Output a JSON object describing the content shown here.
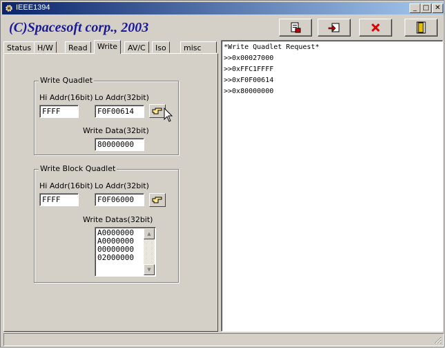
{
  "window": {
    "title": "IEEE1394"
  },
  "title_buttons": [
    "minimize",
    "maximize",
    "close"
  ],
  "header": {
    "brand": "(C)Spacesoft corp., 2003"
  },
  "toolbar": [
    {
      "name": "read-file-icon"
    },
    {
      "name": "transfer-icon"
    },
    {
      "name": "clear-icon"
    },
    {
      "name": "exit-door-icon"
    }
  ],
  "tabs": [
    "Status",
    "H/W",
    "Read",
    "Write",
    "AV/C",
    "Iso",
    "misc"
  ],
  "active_tab": "Write",
  "write_quadlet": {
    "title": "Write Quadlet",
    "hi_label": "Hi Addr(16bit)",
    "lo_label": "Lo Addr(32bit)",
    "hi_value": "FFFF",
    "lo_value": "F0F00614",
    "data_label": "Write Data(32bit)",
    "data_value": "80000000"
  },
  "write_block": {
    "title": "Write Block Quadlet",
    "hi_label": "Hi Addr(16bit)",
    "lo_label": "Lo Addr(32bit)",
    "hi_value": "FFFF",
    "lo_value": "F0F06000",
    "datas_label": "Write Datas(32bit)",
    "datas": [
      "A0000000",
      "A0000000",
      "00000000",
      "02000000"
    ]
  },
  "log": [
    "*Write Quadlet Request*",
    ">>0x00027000",
    ">>0xFFC1FFFF",
    ">>0xF0F00614",
    ">>0x80000000"
  ],
  "colors": {
    "title_start": "#0a246a",
    "title_end": "#a6caf0",
    "brand": "#1a1a99",
    "face": "#d4d0c8"
  }
}
